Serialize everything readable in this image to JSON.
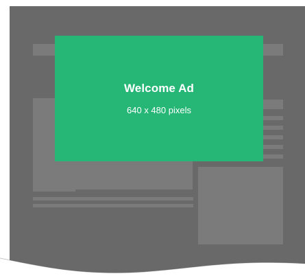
{
  "ad": {
    "title": "Welcome Ad",
    "subtitle": "640 x 480 pixels",
    "background_color": "#26b777",
    "text_color": "#ffffff"
  },
  "backdrop": {
    "color": "#696969",
    "wireframe_color": "#7b7b7b"
  }
}
